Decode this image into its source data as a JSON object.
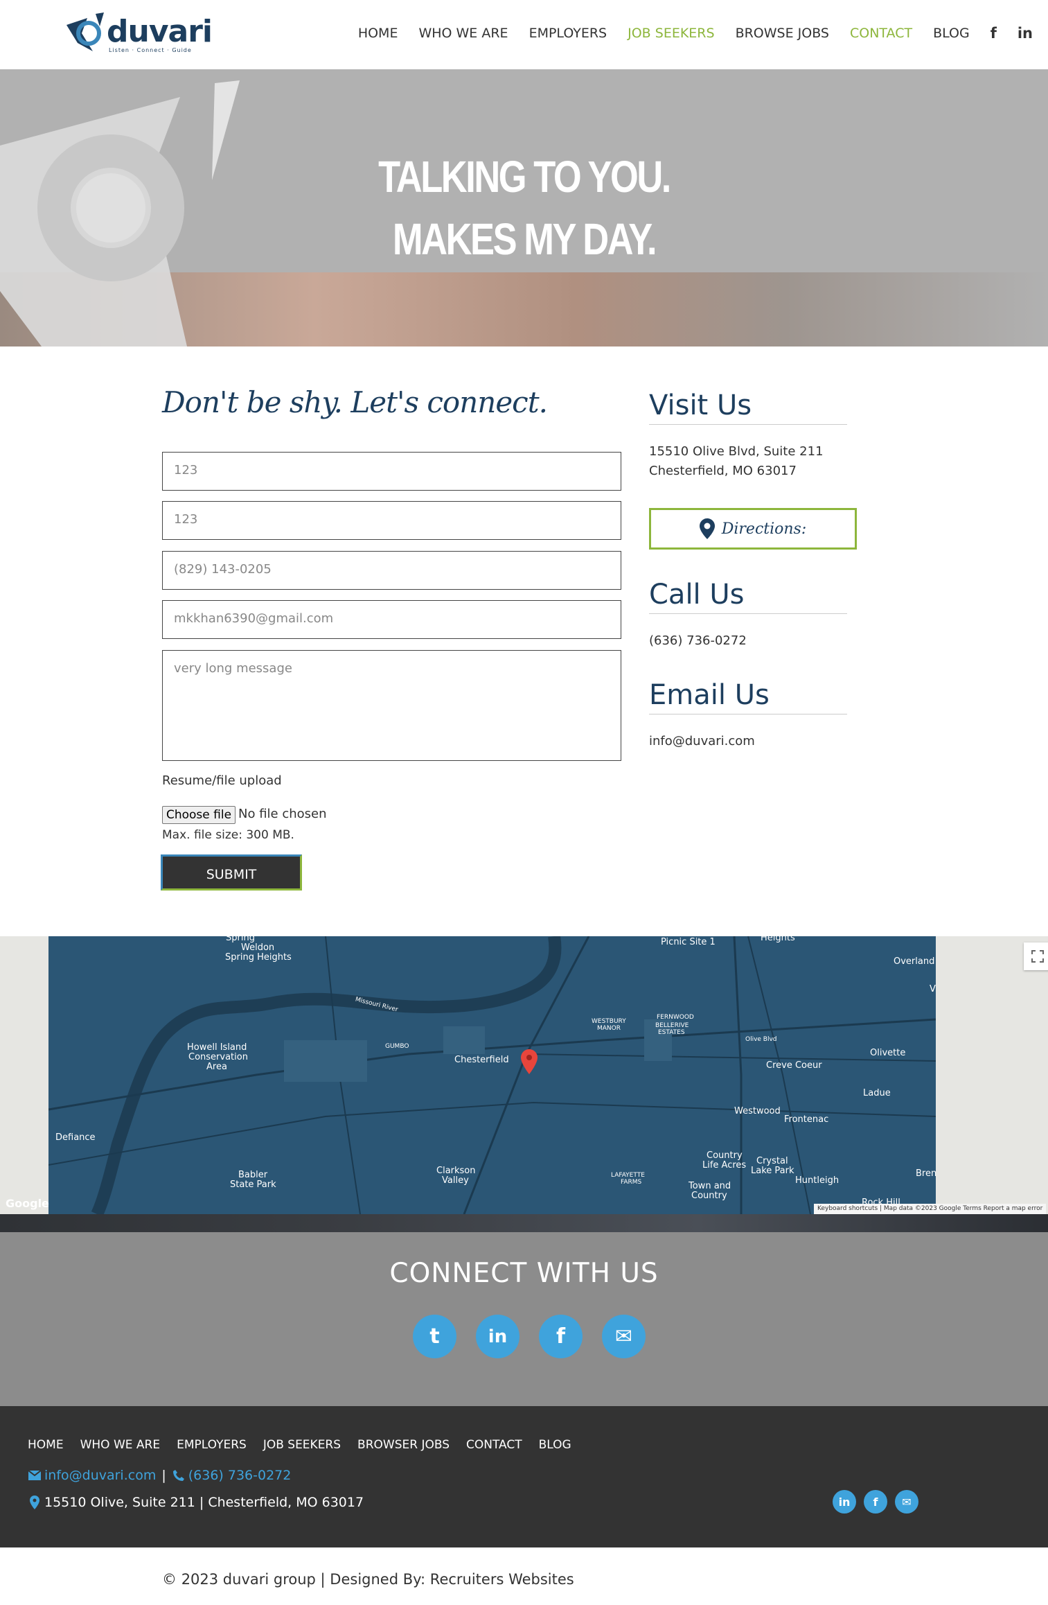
{
  "brand": {
    "name": "duvari",
    "tagline": "Listen · Connect · Guide"
  },
  "nav": {
    "items": [
      {
        "label": "HOME",
        "active": false
      },
      {
        "label": "WHO WE ARE",
        "active": false
      },
      {
        "label": "EMPLOYERS",
        "active": false
      },
      {
        "label": "JOB SEEKERS",
        "active": true
      },
      {
        "label": "BROWSE JOBS",
        "active": false
      },
      {
        "label": "CONTACT",
        "active": true
      },
      {
        "label": "BLOG",
        "active": false
      }
    ],
    "facebook_icon": "f",
    "linkedin_icon": "in"
  },
  "hero": {
    "line1": "TALKING TO YOU.",
    "line2": "MAKES MY DAY."
  },
  "form": {
    "heading": "Don't be shy. Let's connect.",
    "first_name": "123",
    "last_name": "123",
    "phone": "(829) 143-0205",
    "email": "mkkhan6390@gmail.com",
    "message": "very long message",
    "upload_label": "Resume/file upload",
    "choose_file": "Choose file",
    "no_file": "No file chosen",
    "max_size": "Max. file size: 300 MB.",
    "submit": "SUBMIT"
  },
  "visit": {
    "heading": "Visit Us",
    "address_line1": "15510 Olive Blvd, Suite 211",
    "address_line2": "Chesterfield, MO 63017",
    "directions": "Directions:"
  },
  "call": {
    "heading": "Call Us",
    "phone": "(636) 736-0272"
  },
  "email_us": {
    "heading": "Email Us",
    "email": "info@duvari.com"
  },
  "map": {
    "labels": [
      "Spring",
      "Weldon",
      "Spring Heights",
      "Picnic Site 1",
      "Heights",
      "Overland",
      "V",
      "Missouri River",
      "WESTBURY",
      "MANOR",
      "FERNWOOD",
      "BELLERIVE",
      "ESTATES",
      "Olive Blvd",
      "Howell Island",
      "Conservation",
      "Area",
      "GUMBO",
      "Chesterfield",
      "Olivette",
      "Creve Coeur",
      "Ladue",
      "Westwood",
      "Frontenac",
      "Defiance",
      "Babler",
      "State Park",
      "Clarkson",
      "Valley",
      "LAFAYETTE",
      "FARMS",
      "Country",
      "Life Acres",
      "Crystal",
      "Lake Park",
      "Town and",
      "Country",
      "Huntleigh",
      "Bren",
      "Rock Hill"
    ],
    "google": "Google",
    "footer_text": "Keyboard shortcuts  |  Map data ©2023 Google    Terms    Report a map error",
    "marker_color": "#e8453c",
    "water_color": "#1e3e55"
  },
  "connect": {
    "title": "CONNECT WITH US",
    "icons": [
      "twitter-icon",
      "linkedin-icon",
      "facebook-icon",
      "envelope-icon"
    ],
    "twitter_glyph": "t",
    "linkedin_glyph": "in",
    "facebook_glyph": "f",
    "email_glyph": "✉"
  },
  "footer": {
    "nav": [
      "HOME",
      "WHO WE ARE",
      "EMPLOYERS",
      "JOB SEEKERS",
      "BROWSER JOBS",
      "CONTACT",
      "BLOG"
    ],
    "email": "info@duvari.com",
    "separator": "|",
    "phone": "(636) 736-0272",
    "address": "15510 Olive, Suite 211 | Chesterfield, MO 63017",
    "linkedin_glyph": "in",
    "facebook_glyph": "f",
    "email_glyph": "✉"
  },
  "copyright": "2023 duvari group | Designed By: Recruiters Websites",
  "colors": {
    "brand_navy": "#1d3e5e",
    "accent_green": "#8db63c",
    "social_blue": "#3fa3dc",
    "footer_dark": "#333333"
  }
}
